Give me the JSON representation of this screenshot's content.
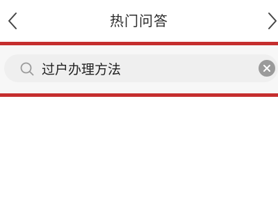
{
  "header": {
    "title": "热门问答",
    "back_icon": "chevron-left-icon",
    "forward_icon": "chevron-right-icon"
  },
  "search": {
    "value": "过户办理方法",
    "icon": "search-icon",
    "clear_icon": "clear-icon"
  },
  "colors": {
    "highlight": "#c52e2e",
    "search_bg": "#efefef",
    "text": "#222222"
  }
}
